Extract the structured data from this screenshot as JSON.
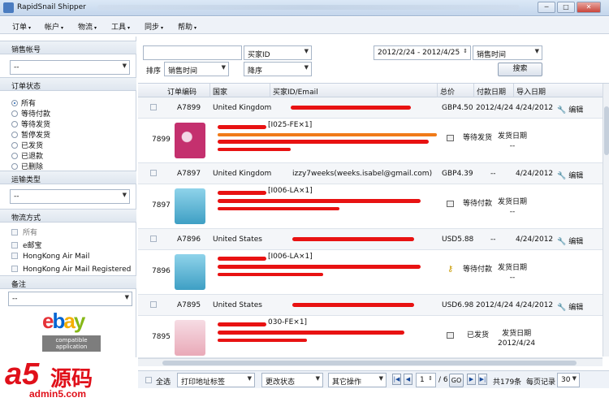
{
  "window": {
    "title": "RapidSnail Shipper",
    "controls": [
      "─",
      "□",
      "✕"
    ]
  },
  "menu": [
    {
      "label": "订单"
    },
    {
      "label": "帐户"
    },
    {
      "label": "物流"
    },
    {
      "label": "工具"
    },
    {
      "label": "同步"
    },
    {
      "label": "帮助"
    }
  ],
  "sidebar": {
    "sales_account": {
      "label": "销售帐号",
      "value": "--"
    },
    "order_status": {
      "label": "订单状态",
      "options": [
        "所有",
        "等待付款",
        "等待发货",
        "暂停发货",
        "已发货",
        "已退款",
        "已删除"
      ],
      "selected": "所有"
    },
    "shipping_type": {
      "label": "运输类型",
      "value": "--"
    },
    "logistics": {
      "label": "物流方式",
      "options": [
        "所有",
        "e邮宝",
        "HongKong Air Mail",
        "HongKong Air Mail Registered"
      ]
    },
    "remark": {
      "label": "备注",
      "value": "--"
    },
    "ebay_badge": {
      "logo": [
        "e",
        "b",
        "a",
        "y"
      ],
      "line1": "compatible",
      "line2": "application"
    }
  },
  "filter": {
    "search_value": "",
    "field_select": "买家ID",
    "date_range": "2012/2/24 - 2012/4/25",
    "date_type": "销售时间",
    "sort_label": "排序",
    "sort_field": "销售时间",
    "sort_order": "降序",
    "search_button": "搜索"
  },
  "grid": {
    "columns": [
      "订单编码",
      "国家",
      "买家ID/Email",
      "总价",
      "付款日期",
      "导入日期"
    ],
    "orders": [
      {
        "code": "A7899",
        "country": "United Kingdom",
        "buyer": "",
        "total": "GBP4.50",
        "paid": "2012/4/24",
        "imported": "4/24/2012",
        "action": "编辑",
        "num": "7899",
        "sku": "[I025-FE×1]",
        "status": "等待发货",
        "ship_label": "发货日期",
        "ship_date": "--",
        "thumb_color": "#c4306e"
      },
      {
        "code": "A7897",
        "country": "United Kingdom",
        "buyer": "izzy7weeks(weeks.isabel@gmail.com)",
        "total": "GBP4.39",
        "paid": "--",
        "imported": "4/24/2012",
        "action": "编辑",
        "num": "7897",
        "sku": "[I006-LA×1]",
        "status": "等待付款",
        "ship_label": "发货日期",
        "ship_date": "--",
        "thumb_color": "#5fb7d6"
      },
      {
        "code": "A7896",
        "country": "United States",
        "buyer": "",
        "total": "USD5.88",
        "paid": "--",
        "imported": "4/24/2012",
        "action": "编辑",
        "num": "7896",
        "sku": "[I006-LA×1]",
        "status": "等待付款",
        "ship_label": "发货日期",
        "ship_date": "--",
        "thumb_color": "#5fb7d6"
      },
      {
        "code": "A7895",
        "country": "United States",
        "buyer": "",
        "total": "USD6.98",
        "paid": "2012/4/24",
        "imported": "4/24/2012",
        "action": "编辑",
        "num": "7895",
        "sku": "030-FE×1]",
        "status": "已发货",
        "ship_label": "发货日期",
        "ship_date": "2012/4/24",
        "thumb_color": "#e9a9b8"
      }
    ]
  },
  "bottom": {
    "select_all": "全选",
    "print_label": "打印地址标签",
    "change_status": "更改状态",
    "other_ops": "其它操作",
    "page_value": "1",
    "page_total": "/ 6",
    "go": "GO",
    "total_count": "共179条",
    "per_page_label": "每页记录",
    "per_page": "30"
  },
  "watermark": {
    "brand": "a5",
    "cn": "源码",
    "url": "admin5.com"
  }
}
